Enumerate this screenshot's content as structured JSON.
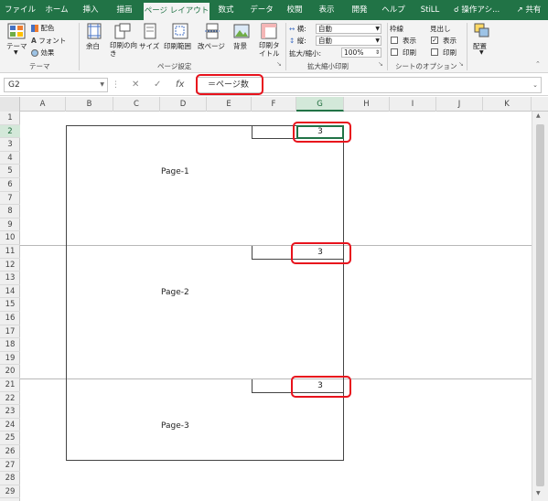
{
  "tabs": [
    "ファイル",
    "ホーム",
    "挿入",
    "描画",
    "ページ レイアウト",
    "数式",
    "データ",
    "校閲",
    "表示",
    "開発",
    "ヘルプ",
    "StiLL"
  ],
  "tell_me": "操作アシ...",
  "share": "共有",
  "ribbon": {
    "theme_group": {
      "theme_button": "テーマ",
      "colors": "配色",
      "fonts": "フォント",
      "effects": "効果",
      "label": "テーマ"
    },
    "page_setup_group": {
      "buttons": [
        "余白",
        "印刷の向き",
        "サイズ",
        "印刷範囲",
        "改ページ",
        "背景",
        "印刷タイトル"
      ],
      "label": "ページ設定"
    },
    "scale_group": {
      "width_label": "横:",
      "width_value": "自動",
      "height_label": "縦:",
      "height_value": "自動",
      "scale_label": "拡大/縮小:",
      "scale_value": "100%",
      "label": "拡大縮小印刷"
    },
    "sheet_options_group": {
      "gridlines_title": "枠線",
      "headings_title": "見出し",
      "view": "表示",
      "print": "印刷",
      "gridlines_view_checked": false,
      "gridlines_print_checked": false,
      "headings_view_checked": true,
      "headings_print_checked": false,
      "label": "シートのオプション"
    },
    "arrange_group": {
      "button": "配置"
    }
  },
  "formula_bar": {
    "name_box": "G2",
    "formula": "＝ページ数"
  },
  "sheet": {
    "columns": [
      "A",
      "B",
      "C",
      "D",
      "E",
      "F",
      "G",
      "H",
      "I",
      "J",
      "K"
    ],
    "selected_column": "G",
    "rows": [
      "1",
      "2",
      "3",
      "4",
      "5",
      "6",
      "7",
      "8",
      "9",
      "10",
      "11",
      "12",
      "13",
      "14",
      "15",
      "16",
      "17",
      "18",
      "19",
      "20",
      "21",
      "22",
      "23",
      "24",
      "25",
      "26",
      "27",
      "28",
      "29"
    ],
    "selected_row": "2",
    "page_labels": [
      "Page-1",
      "Page-2",
      "Page-3"
    ],
    "page_count_values": [
      "3",
      "3",
      "3"
    ]
  },
  "colors": {
    "accent": "#217346",
    "highlight": "#e8121c"
  }
}
